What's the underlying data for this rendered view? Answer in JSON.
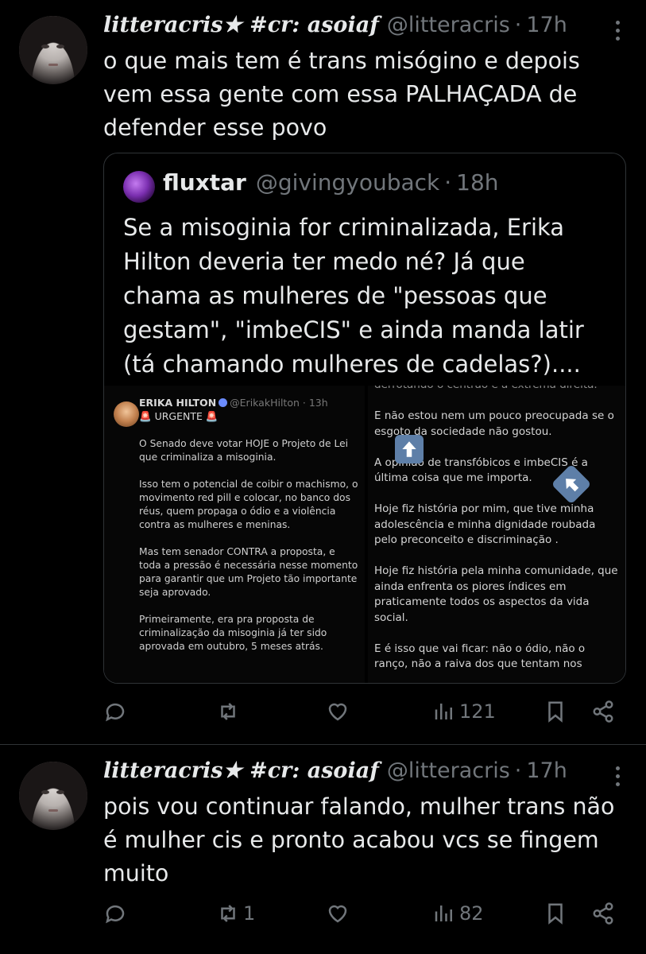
{
  "tweets": [
    {
      "display_name": "litteracris★ #cr: asoiaf",
      "handle": "@litteracris",
      "separator": "·",
      "time": "17h",
      "text": "o que mais tem é trans misógino e depois vem essa gente com essa PALHAÇADA de defender esse povo",
      "quote": {
        "name": "fluxtar",
        "handle": "@givingyouback",
        "separator": "·",
        "time": "18h",
        "text": "Se a misoginia for criminalizada, Erika Hilton deveria ter medo né? Já que chama as mulheres de \"pessoas que gestam\", \"imbeCIS\" e ainda manda latir (tá chamando mulheres de cadelas?)....",
        "media_left": {
          "name": "ERIKA HILTON",
          "handle": "@ErikakHilton · 13h",
          "urgent": "URGENTE",
          "siren": "🚨",
          "paragraphs": [
            "O Senado deve votar HOJE o Projeto de Lei que criminaliza a misoginia.",
            "Isso tem o potencial de coibir o machismo, o movimento red pill e colocar, no banco dos réus, quem propaga o ódio e a violência contra as mulheres e meninas.",
            "Mas tem senador CONTRA a proposta, e toda a pressão é necessária nesse momento para garantir que um Projeto tão importante seja aprovado.",
            "Primeiramente, era pra proposta de criminalização da misoginia já ter sido aprovada em outubro, 5 meses atrás."
          ]
        },
        "media_right": {
          "cut_line": "derrotando o centrão e a extrema direita.",
          "paragraphs": [
            "E não estou nem um pouco preocupada se o esgoto da sociedade não gostou.",
            "A opinião de transfóbicos e imbeCIS é a última coisa que me importa.",
            "Hoje fiz história por mim, que tive minha adolescência e minha dignidade roubada pelo preconceito e discriminação .",
            "Hoje fiz história pela minha comunidade, que ainda enfrenta os piores índices em praticamente todos os aspectos da vida social.",
            "E é isso que vai ficar: não o ódio, não o ranço, não a raiva dos que tentam nos"
          ]
        }
      },
      "actions": {
        "replies": "",
        "retweets": "",
        "likes": "",
        "views": "121"
      }
    },
    {
      "display_name": "litteracris★ #cr: asoiaf",
      "handle": "@litteracris",
      "separator": "·",
      "time": "17h",
      "text": "pois vou continuar falando, mulher trans não é mulher cis e pronto acabou vcs se fingem muito",
      "actions": {
        "replies": "",
        "retweets": "1",
        "likes": "",
        "views": "82"
      }
    }
  ],
  "icons": [
    "reply-icon",
    "retweet-icon",
    "like-icon",
    "views-icon",
    "bookmark-icon",
    "share-icon",
    "more-icon",
    "verified-icon",
    "arrow-up-icon"
  ],
  "colors": {
    "background": "#000000",
    "text": "#e7e9ea",
    "muted": "#71767b",
    "border": "#2f3336"
  }
}
